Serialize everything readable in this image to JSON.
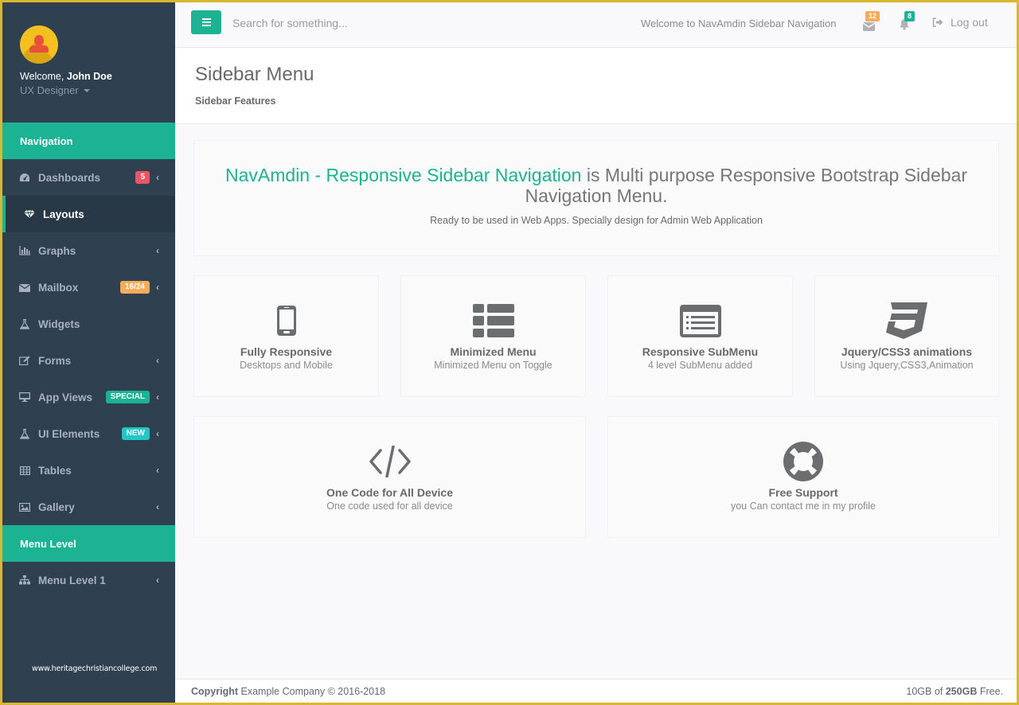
{
  "colors": {
    "accent": "#1bb394",
    "sidebar_bg": "#2f4050",
    "badge_red": "#ed5565",
    "badge_orange": "#f8ac59",
    "badge_teal": "#1bb394",
    "badge_cyan": "#23c6c8"
  },
  "profile": {
    "welcome_prefix": "Welcome, ",
    "name": "John Doe",
    "role": "UX Designer"
  },
  "sidebar": {
    "sections": [
      {
        "header": "Navigation",
        "items": [
          {
            "label": "Dashboards",
            "icon": "dashboard-icon",
            "badge": "5",
            "badge_color": "#ed5565",
            "chevron": true
          },
          {
            "label": "Layouts",
            "icon": "diamond-icon",
            "active": true,
            "chevron": false
          },
          {
            "label": "Graphs",
            "icon": "bar-chart-icon",
            "chevron": true
          },
          {
            "label": "Mailbox",
            "icon": "envelope-icon",
            "badge": "16/24",
            "badge_color": "#f8ac59",
            "chevron": true
          },
          {
            "label": "Widgets",
            "icon": "flask-icon",
            "chevron": false
          },
          {
            "label": "Forms",
            "icon": "edit-icon",
            "chevron": true
          },
          {
            "label": "App Views",
            "icon": "desktop-icon",
            "badge": "SPECIAL",
            "badge_color": "#1bb394",
            "chevron": true
          },
          {
            "label": "UI Elements",
            "icon": "flask-icon",
            "badge": "NEW",
            "badge_color": "#23c6c8",
            "chevron": true
          },
          {
            "label": "Tables",
            "icon": "table-icon",
            "chevron": true
          },
          {
            "label": "Gallery",
            "icon": "picture-icon",
            "chevron": true
          }
        ]
      },
      {
        "header": "Menu Level",
        "items": [
          {
            "label": "Menu Level 1",
            "icon": "sitemap-icon",
            "chevron": true
          }
        ]
      }
    ],
    "watermark": "www.heritagechristiancollege.com",
    "chevron_glyph": "‹"
  },
  "topbar": {
    "search_placeholder": "Search for something...",
    "welcome": "Welcome to NavAmdin Sidebar Navigation",
    "messages_count": "12",
    "alerts_count": "8",
    "logout_label": "Log out"
  },
  "heading": {
    "title": "Sidebar Menu",
    "subtitle": "Sidebar Features"
  },
  "hero": {
    "accent_text": "NavAmdin - Responsive Sidebar Navigation",
    "text": " is Multi purpose Responsive Bootstrap Sidebar Navigation Menu.",
    "description": "Ready to be used in Web Apps. Specially design for Admin Web Application"
  },
  "features": [
    {
      "icon": "mobile-icon",
      "title": "Fully Responsive",
      "desc": "Desktops and Mobile"
    },
    {
      "icon": "th-list-icon",
      "title": "Minimized Menu",
      "desc": "Minimized Menu on Toggle"
    },
    {
      "icon": "list-alt-icon",
      "title": "Responsive SubMenu",
      "desc": "4 level SubMenu added"
    },
    {
      "icon": "css3-icon",
      "title": "Jquery/CSS3 animations",
      "desc": "Using Jquery,CSS3,Animation"
    },
    {
      "icon": "code-icon",
      "title": "One Code for All Device",
      "desc": "One code used for all device"
    },
    {
      "icon": "life-ring-icon",
      "title": "Free Support",
      "desc": "you Can contact me in my profile"
    }
  ],
  "footer": {
    "copyright_label": "Copyright",
    "copyright_text": " Example Company © 2016-2018",
    "storage_used": "10GB",
    "storage_of": " of ",
    "storage_total": "250GB",
    "storage_suffix": " Free."
  }
}
